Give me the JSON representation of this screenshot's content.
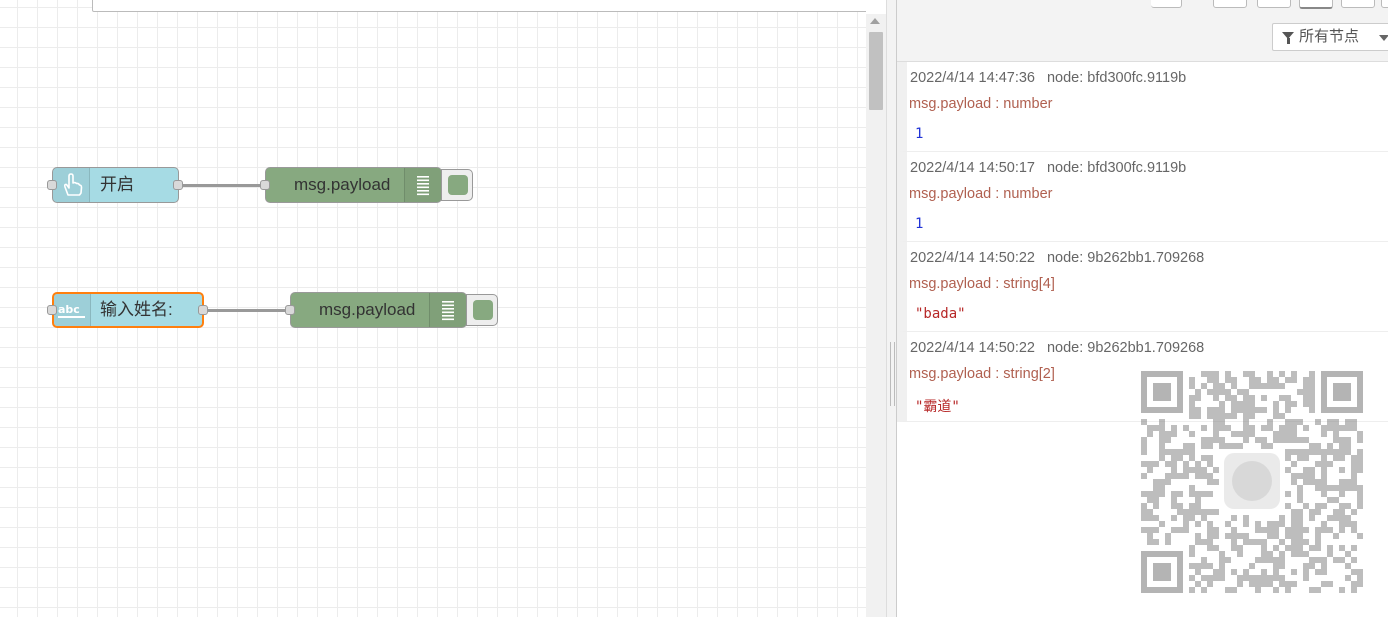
{
  "canvas": {
    "nodes": [
      {
        "id": "inject",
        "type": "inject",
        "label": "开启",
        "icon": "hand-pointer-icon"
      },
      {
        "id": "debug1",
        "type": "debug",
        "label": "msg.payload",
        "icon": "list-icon"
      },
      {
        "id": "text-input",
        "type": "inject",
        "label": "输入姓名:",
        "icon": "abc-icon",
        "selected": true
      },
      {
        "id": "debug2",
        "type": "debug",
        "label": "msg.payload",
        "icon": "list-icon"
      }
    ],
    "colors": {
      "inject": "#a6dbe4",
      "debug": "#87a980",
      "selected": "#ff7f0e",
      "wire": "#999999"
    }
  },
  "sidebar": {
    "filter_label": "所有节点",
    "messages": [
      {
        "timestamp": "2022/4/14 14:47:36",
        "node": "node: bfd300fc.9119b",
        "topic": "msg.payload : number",
        "value": "1",
        "kind": "number"
      },
      {
        "timestamp": "2022/4/14 14:50:17",
        "node": "node: bfd300fc.9119b",
        "topic": "msg.payload : number",
        "value": "1",
        "kind": "number"
      },
      {
        "timestamp": "2022/4/14 14:50:22",
        "node": "node: 9b262bb1.709268",
        "topic": "msg.payload : string[4]",
        "value": "\"bada\"",
        "kind": "string"
      },
      {
        "timestamp": "2022/4/14 14:50:22",
        "node": "node: 9b262bb1.709268",
        "topic": "msg.payload : string[2]",
        "value": "\"霸道\"",
        "kind": "string"
      }
    ]
  }
}
